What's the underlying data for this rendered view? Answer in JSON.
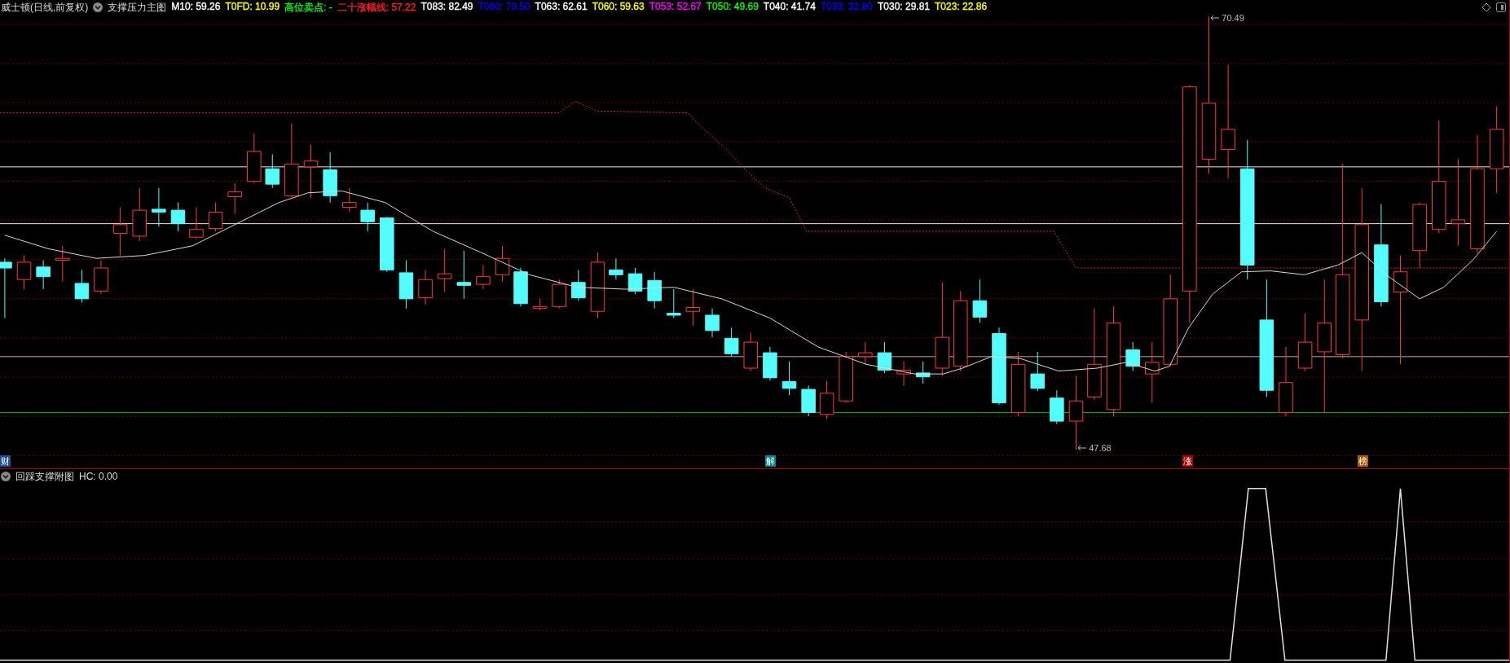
{
  "header": {
    "title": "威士顿(日线,前复权)",
    "indicator": "支撑压力主图",
    "values": [
      {
        "text": "M10: 59.26",
        "color": "#ffffff"
      },
      {
        "text": "T0FD: 10.99",
        "color": "#ffff00"
      },
      {
        "text": "高位卖点: -",
        "color": "#00ff00"
      },
      {
        "text": "二十涨幅线: 57.22",
        "color": "#ff2020"
      },
      {
        "text": "T083: 82.49",
        "color": "#ffffff"
      },
      {
        "text": "T080: 79.50",
        "color": "#0000ff"
      },
      {
        "text": "T063: 62.61",
        "color": "#ffffff"
      },
      {
        "text": "T060: 59.63",
        "color": "#ffff00"
      },
      {
        "text": "T053: 52.67",
        "color": "#ff00ff"
      },
      {
        "text": "T050: 49.69",
        "color": "#00ff00"
      },
      {
        "text": "T040: 41.74",
        "color": "#ffffff"
      },
      {
        "text": "T033: 32.80",
        "color": "#0000ff"
      },
      {
        "text": "T030: 29.81",
        "color": "#ffffff"
      },
      {
        "text": "T023: 22.86",
        "color": "#ffff00"
      }
    ]
  },
  "main_chart": {
    "high_label": "70.49",
    "low_label": "47.68",
    "markers": [
      {
        "text": "财",
        "color": "#1f4f9a"
      },
      {
        "text": "解",
        "color": "#00868b"
      },
      {
        "text": "涨",
        "color": "#a80000"
      },
      {
        "text": "榜",
        "color": "#b05a00"
      }
    ]
  },
  "sub_chart": {
    "title": "回踩支撑附图",
    "value": "HC: 0.00"
  }
}
